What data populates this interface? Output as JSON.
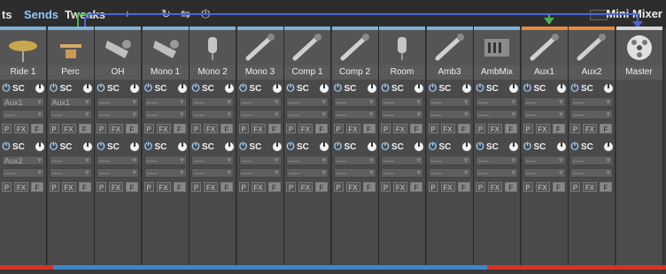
{
  "header": {
    "tabs": [
      {
        "label": "ts"
      },
      {
        "label": "Sends"
      },
      {
        "label": "Tweaks"
      }
    ],
    "mini_mixer_label": "Mini Mixer"
  },
  "labels": {
    "sc": "SC",
    "p": "P",
    "fx": "FX",
    "f": "F",
    "empty_send": "----"
  },
  "colors": {
    "accent_blue": "#8ec9ff",
    "route_green": "#4caf50",
    "route_blue": "#4a67d6",
    "bar_red": "#d8312c",
    "bar_blue": "#3e86c8"
  },
  "channels": [
    {
      "name": "Ride 1",
      "icon": "cymbal-icon",
      "color": "#7fb3d5",
      "sends": [
        "Aux1",
        "----",
        "Aux2",
        "----"
      ]
    },
    {
      "name": "Perc",
      "icon": "percussion-icon",
      "color": "#7fb3d5",
      "sends": [
        "Aux1",
        "----",
        "----",
        "----"
      ]
    },
    {
      "name": "OH",
      "icon": "overhead-mic-icon",
      "color": "#7fb3d5",
      "sends": [
        "----",
        "----",
        "----",
        "----"
      ]
    },
    {
      "name": "Mono 1",
      "icon": "overhead-mic-icon",
      "color": "#7fb3d5",
      "sends": [
        "----",
        "----",
        "----",
        "----"
      ]
    },
    {
      "name": "Mono 2",
      "icon": "condenser-mic-icon",
      "color": "#7fb3d5",
      "sends": [
        "----",
        "----",
        "----",
        "----"
      ]
    },
    {
      "name": "Mono 3",
      "icon": "stick-mic-icon",
      "color": "#7fb3d5",
      "sends": [
        "----",
        "----",
        "----",
        "----"
      ]
    },
    {
      "name": "Comp 1",
      "icon": "stick-mic-icon",
      "color": "#7fb3d5",
      "sends": [
        "----",
        "----",
        "----",
        "----"
      ]
    },
    {
      "name": "Comp 2",
      "icon": "stick-mic-icon",
      "color": "#7fb3d5",
      "sends": [
        "----",
        "----",
        "----",
        "----"
      ]
    },
    {
      "name": "Room",
      "icon": "condenser-mic-icon",
      "color": "#7fb3d5",
      "sends": [
        "----",
        "----",
        "----",
        "----"
      ]
    },
    {
      "name": "Amb3",
      "icon": "stick-mic-icon",
      "color": "#7fb3d5",
      "sends": [
        "----",
        "----",
        "----",
        "----"
      ]
    },
    {
      "name": "AmbMix",
      "icon": "mixer-icon",
      "color": "#7fb3d5",
      "sends": [
        "----",
        "----",
        "----",
        "----"
      ]
    },
    {
      "name": "Aux1",
      "icon": "stick-mic-icon",
      "color": "#e58b3a",
      "sends": [
        "----",
        "----",
        "----",
        "----"
      ]
    },
    {
      "name": "Aux2",
      "icon": "stick-mic-icon",
      "color": "#e58b3a",
      "sends": [
        "----",
        "----",
        "----",
        "----"
      ]
    },
    {
      "name": "Master",
      "icon": "reel-icon",
      "color": "#d6d6d6",
      "sends": []
    }
  ]
}
